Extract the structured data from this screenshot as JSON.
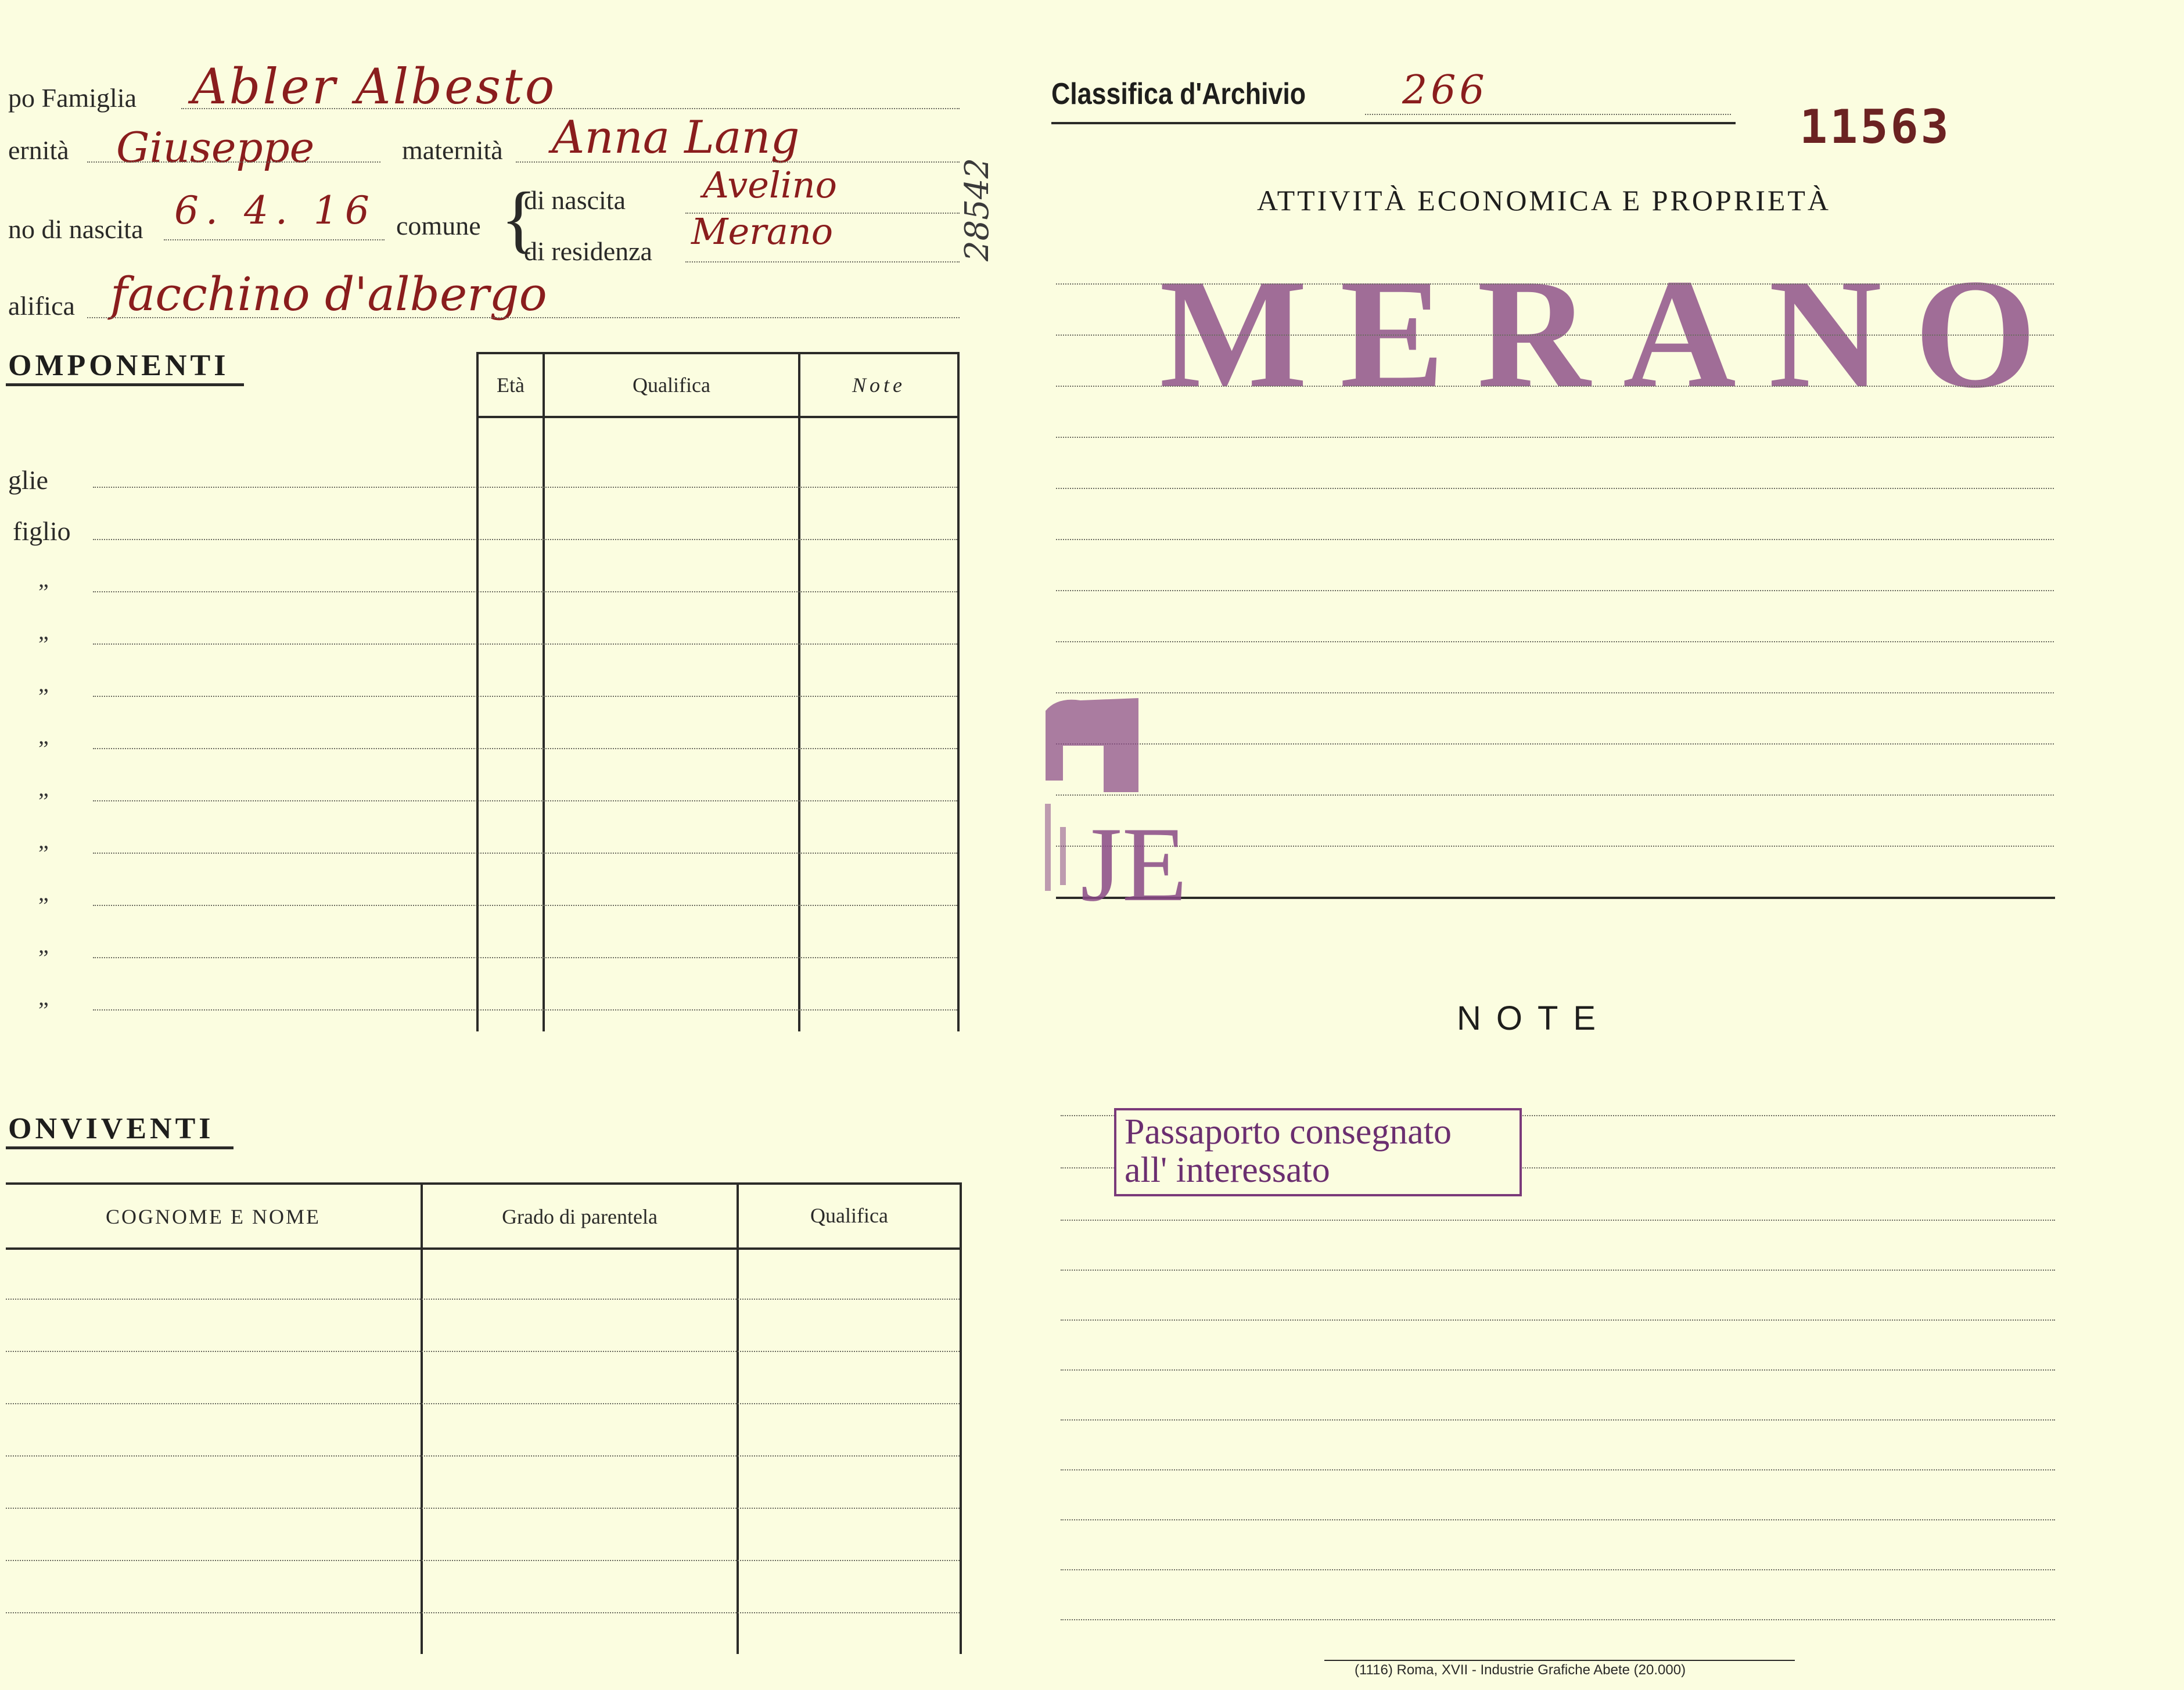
{
  "left": {
    "capo_famiglia_label": "po Famiglia",
    "capo_famiglia_value": "Abler Albesto",
    "paternita_label": "ernità",
    "paternita_value": "Giuseppe",
    "maternita_label": "maternità",
    "maternita_value": "Anna Lang",
    "data_nascita_label": "no di nascita",
    "data_nascita_value": "6. 4. 16",
    "comune_label": "comune",
    "nascita_label": "di nascita",
    "nascita_value": "Avelino",
    "residenza_label": "di residenza",
    "residenza_value": "Merano",
    "qualifica_label": "alifica",
    "qualifica_value": "facchino d'albergo",
    "margin_number": "28542",
    "componenti_heading": "OMPONENTI",
    "componenti_columns": [
      "Età",
      "Qualifica",
      "Note"
    ],
    "componenti_rows": [
      "glie",
      "figlio",
      "”",
      "”",
      "”",
      "”",
      "”",
      "”",
      "”",
      "”",
      "”"
    ],
    "conviventi_heading": "ONVIVENTI",
    "conviventi_columns": [
      "COGNOME E NOME",
      "Grado di parentela",
      "Qualifica"
    ]
  },
  "right": {
    "classifica_label": "Classifica d'Archivio",
    "classifica_value": "266",
    "card_number": "11563",
    "section_title": "ATTIVITÀ ECONOMICA E PROPRIETÀ",
    "city_stamp": "MERANO",
    "stamp_letters": "JE",
    "notes_title": "NOTE",
    "passport_stamp_line1": "Passaporto consegnato",
    "passport_stamp_line2": "all' interessato"
  },
  "footer": {
    "printer_imprint": "(1116) Roma, XVII - Industrie Grafiche Abete (20.000)"
  },
  "colors": {
    "paper": "#fbfde0",
    "ink_handwriting": "#8a1d1d",
    "stamp_purple": "#8a4a86",
    "rule": "#2b2b28"
  }
}
